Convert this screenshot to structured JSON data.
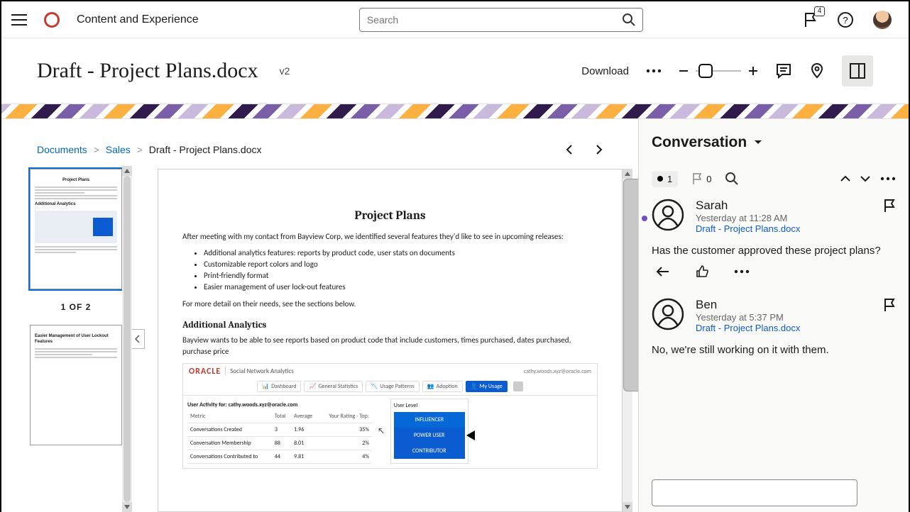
{
  "topbar": {
    "brand": "Content and Experience",
    "search_placeholder": "Search",
    "flag_count": "4"
  },
  "docheader": {
    "title": "Draft - Project Plans.docx",
    "version": "v2",
    "download": "Download"
  },
  "breadcrumbs": {
    "root": "Documents",
    "folder": "Sales",
    "file": "Draft - Project Plans.docx"
  },
  "thumbs": {
    "indicator": "1 OF 2"
  },
  "doc": {
    "title": "Project Plans",
    "intro": "After meeting with my contact from Bayview Corp, we identified several features they'd like to see in upcoming releases:",
    "bullets": [
      "Additional analytics features: reports by product code, user stats on documents",
      "Customizable report colors and logo",
      "Print-friendly format",
      "Easier management of user lock-out features"
    ],
    "more": "For more detail on their needs, see the sections below.",
    "section1": "Additional Analytics",
    "section1_body": "Bayview wants to be able to see reports based on product code that include customers, times purchased, dates purchased, purchase price",
    "embed": {
      "brand": "ORACLE",
      "brand_sub": "Social Network Analytics",
      "email": "cathy.woods.xyz@oracle.com",
      "tabs": [
        "Dashboard",
        "General Statistics",
        "Usage Patterns",
        "Adoption",
        "My Usage"
      ],
      "caption": "User Activity for: cathy.woods.xyz@oracle.com",
      "cols": [
        "Metric",
        "Total",
        "Average",
        "Your Rating - Top:"
      ],
      "rows": [
        [
          "Conversations Created",
          "3",
          "1.96",
          "35%"
        ],
        [
          "Conversation Membership",
          "88",
          "8.01",
          "2%"
        ],
        [
          "Conversations Contributed to",
          "44",
          "9.81",
          "4%"
        ]
      ],
      "level_title": "User Level",
      "levels": [
        "INFLUENCER",
        "POWER USER",
        "CONTRIBUTOR"
      ]
    }
  },
  "convo": {
    "title": "Conversation",
    "unread": "1",
    "flagged": "0",
    "messages": [
      {
        "name": "Sarah",
        "time": "Yesterday at 11:28 AM",
        "file": "Draft - Project Plans.docx",
        "text": "Has the customer approved these project plans?",
        "is_new": true
      },
      {
        "name": "Ben",
        "time": "Yesterday at 5:37 PM",
        "file": "Draft - Project Plans.docx",
        "text": "No, we're still working on it with them.",
        "is_new": false
      }
    ]
  }
}
